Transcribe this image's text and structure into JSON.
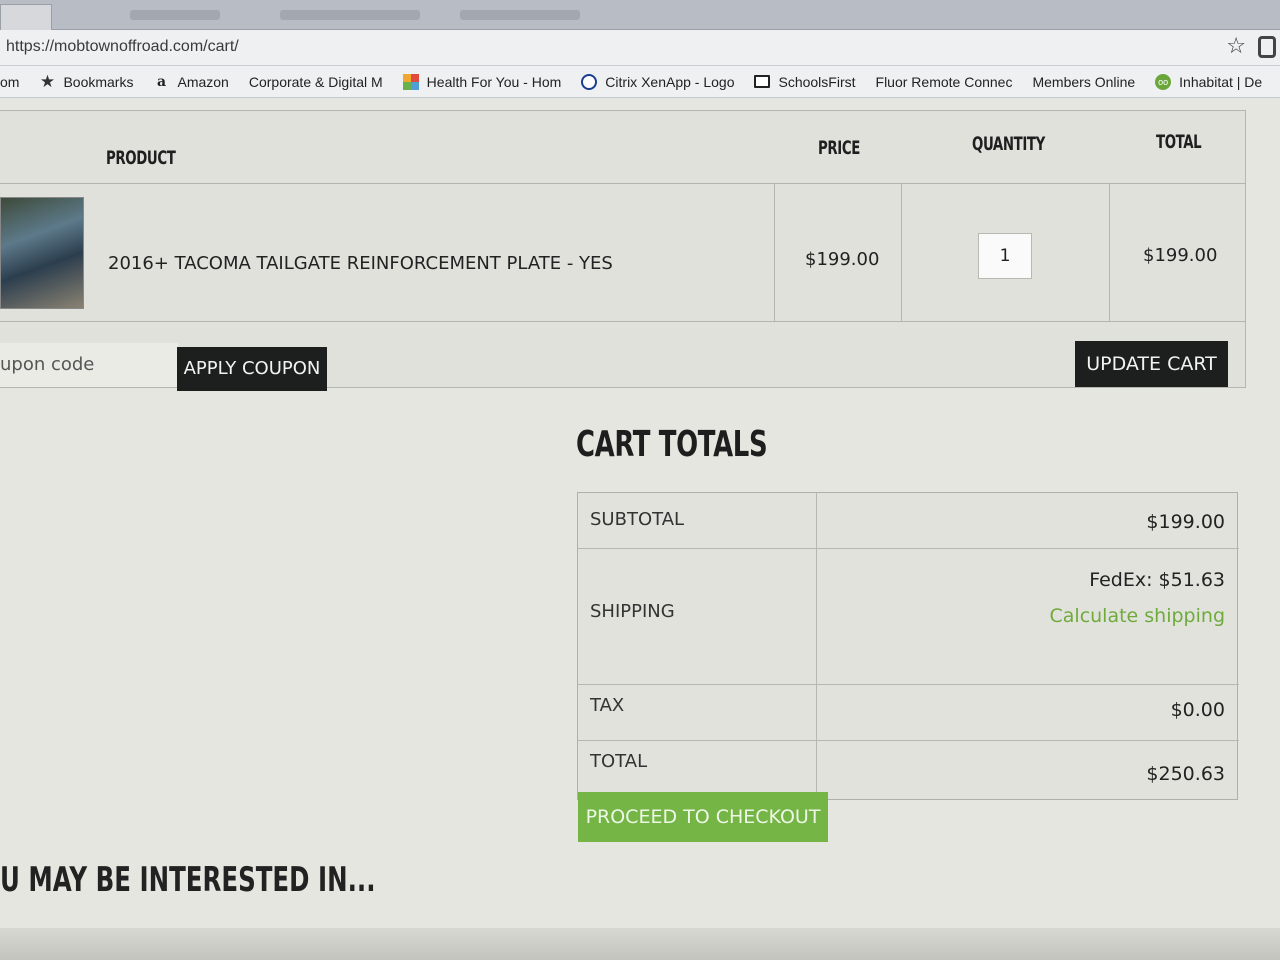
{
  "browser": {
    "url": "https://mobtownoffroad.com/cart/",
    "bookmarks": [
      {
        "label": "om",
        "icon": "none"
      },
      {
        "label": "Bookmarks",
        "icon": "star-icon"
      },
      {
        "label": "Amazon",
        "icon": "amazon-icon"
      },
      {
        "label": "Corporate & Digital M",
        "icon": "page-icon"
      },
      {
        "label": "Health For You - Hom",
        "icon": "grid-icon"
      },
      {
        "label": "Citrix XenApp - Logo",
        "icon": "citrix-icon"
      },
      {
        "label": "SchoolsFirst",
        "icon": "monitor-icon"
      },
      {
        "label": "Fluor Remote Connec",
        "icon": "page-icon"
      },
      {
        "label": "Members Online",
        "icon": "page-icon"
      },
      {
        "label": "Inhabitat | De",
        "icon": "owl-icon"
      }
    ]
  },
  "cart": {
    "headers": {
      "product": "PRODUCT",
      "price": "PRICE",
      "quantity": "QUANTITY",
      "total": "TOTAL"
    },
    "item": {
      "name": "2016+ TACOMA TAILGATE REINFORCEMENT PLATE - YES",
      "price": "$199.00",
      "quantity": "1",
      "total": "$199.00"
    },
    "coupon_placeholder": "upon code",
    "apply_coupon_label": "APPLY COUPON",
    "update_cart_label": "UPDATE CART"
  },
  "totals": {
    "heading": "CART TOTALS",
    "subtotal_label": "SUBTOTAL",
    "subtotal_value": "$199.00",
    "shipping_label": "SHIPPING",
    "shipping_value": "FedEx: $51.63",
    "calculate_shipping": "Calculate shipping",
    "tax_label": "TAX",
    "tax_value": "$0.00",
    "total_label": "TOTAL",
    "total_value": "$250.63",
    "checkout_label": "PROCEED TO CHECKOUT"
  },
  "related": {
    "heading": "U MAY BE INTERESTED IN..."
  },
  "colors": {
    "accent_green": "#74b546",
    "dark_button": "#1d1f1e"
  }
}
